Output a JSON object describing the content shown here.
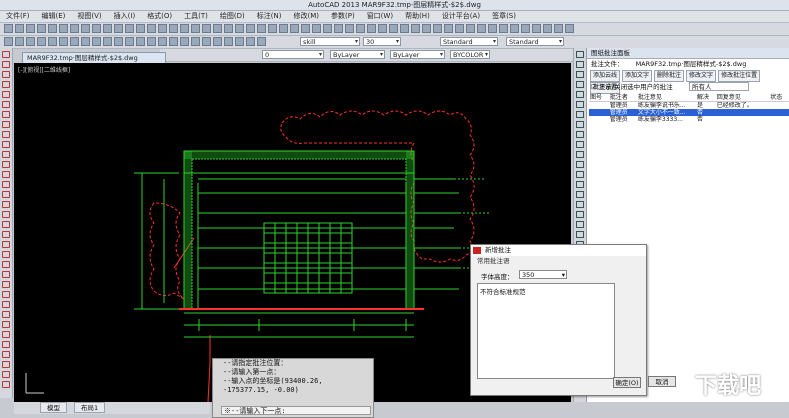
{
  "window": {
    "title": "AutoCAD 2013    MAR9F32.tmp·图层精样式-$2$.dwg"
  },
  "menu": [
    "文件(F)",
    "编辑(E)",
    "视图(V)",
    "插入(I)",
    "格式(O)",
    "工具(T)",
    "绘图(D)",
    "标注(N)",
    "修改(M)",
    "参数(P)",
    "窗口(W)",
    "帮助(H)",
    "设计平台(A)",
    "签章(S)"
  ],
  "toolbar": {
    "style_combo_1": "skill",
    "style_combo_2": "30",
    "style_combo_3": "Standard",
    "style_combo_4": "Standard",
    "layer_combo": "0",
    "color_combo": "ByLayer",
    "linetype_combo": "ByLayer",
    "plotstyle_combo": "BYCOLOR"
  },
  "document": {
    "tab": "MAR9F32.tmp·图层精样式-$2$.dwg",
    "viewport_label": "[-][俯视][二维线框]"
  },
  "command": {
    "lines": [
      "--请指定批注位置：",
      "--请输入第一点：",
      "--输入点的坐标是(93400.26,",
      "-175377.15, -0.00)"
    ],
    "input": "※--请输入下一点:"
  },
  "layout_tabs": [
    "模型",
    "布局1"
  ],
  "panel": {
    "header": "图纸批注面板",
    "file_label": "批注文件：",
    "file_name": "MAR9F32.tmp·图层精样式-$2$.dwg",
    "buttons": [
      "添加云线",
      "添加文字",
      "删除批注",
      "修改文字",
      "修改批注位置",
      "批注设置"
    ],
    "filter_label": "显示/关闭选中用户的批注",
    "filter_user": "所有人",
    "columns": [
      "图号",
      "批注者",
      "批注意见",
      "解决",
      "回复意见",
      "状态"
    ],
    "rows": [
      {
        "no": "",
        "author": "管理员",
        "comment": "练友骗李说书乐...",
        "solved": "是",
        "reply": "已经修改了。",
        "status": ""
      },
      {
        "no": "",
        "author": "管理员",
        "comment": "文字大小不一致...",
        "solved": "否",
        "reply": "",
        "status": ""
      },
      {
        "no": "",
        "author": "管理员",
        "comment": "练友骗李3333...",
        "solved": "否",
        "reply": "",
        "status": ""
      }
    ],
    "selected_row": 1
  },
  "dialog": {
    "title": "新增批注",
    "section": "常用批注语",
    "font_label": "字体高度：",
    "font_value": "350",
    "text": "不符合标准规范",
    "ok": "确定(O)",
    "cancel": "取消"
  },
  "watermark": "下载吧",
  "colors": {
    "canvas": "#000000",
    "drawing": "#2ed62e",
    "cloud": "#ff3030",
    "selection": "#2a5fd6"
  }
}
